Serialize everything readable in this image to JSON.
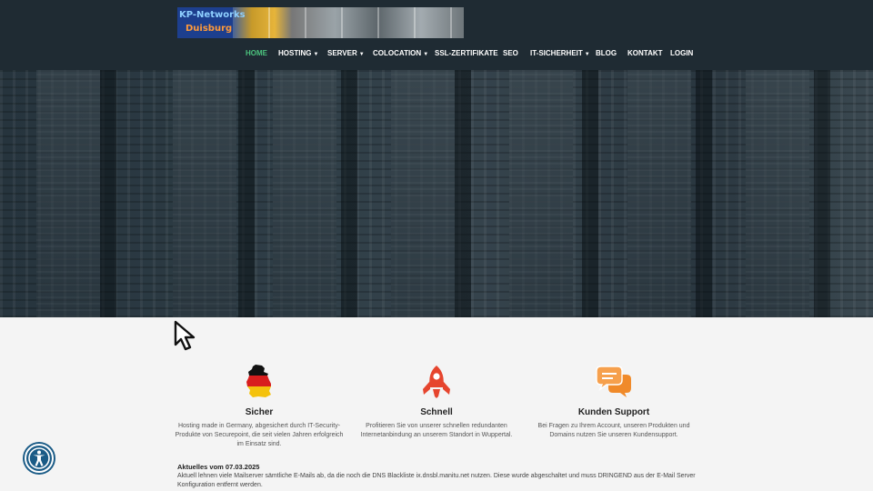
{
  "logo": {
    "line1": "KP-Networks",
    "line2": "Duisburg"
  },
  "nav": [
    {
      "label": "HOME",
      "active": true,
      "dropdown": false
    },
    {
      "label": "HOSTING",
      "dropdown": true
    },
    {
      "label": "SERVER",
      "dropdown": true
    },
    {
      "label": "COLOCATION",
      "dropdown": true
    },
    {
      "label": "SSL-ZERTIFIKATE",
      "dropdown": false
    },
    {
      "label": "SEO",
      "dropdown": false
    },
    {
      "label": "IT-SICHERHEIT",
      "dropdown": true
    },
    {
      "label": "BLOG",
      "dropdown": false
    },
    {
      "label": "KONTAKT",
      "dropdown": false
    },
    {
      "label": "LOGIN",
      "dropdown": false
    }
  ],
  "features": [
    {
      "title": "Sicher",
      "desc": "Hosting made in Germany, abgesichert durch IT-Security-Produkte von Securepoint, die seit vielen Jahren erfolgreich im Einsatz sind.",
      "icon": "germany-map-icon"
    },
    {
      "title": "Schnell",
      "desc": "Profitieren Sie von unserer schnellen redundanten Internetanbindung an unserem Standort in Wuppertal.",
      "icon": "rocket-icon"
    },
    {
      "title": "Kunden Support",
      "desc": "Bei Fragen zu Ihrem Account, unseren Produkten und Domains nutzen Sie unseren Kundensupport.",
      "icon": "chat-bubbles-icon"
    }
  ],
  "news": {
    "title": "Aktuelles vom 07.03.2025",
    "text": "Aktuell lehnen viele Mailserver sämtliche E-Mails ab, da die noch die DNS Blackliste ix.dnsbl.manitu.net nutzen. Diese wurde abgeschaltet und muss DRINGEND aus der E-Mail Server Konfiguration entfernt werden."
  },
  "colors": {
    "nav_active": "#4cc37e",
    "rocket": "#e6452e",
    "chat": "#f08a2a",
    "a11y": "#1a5b86"
  }
}
